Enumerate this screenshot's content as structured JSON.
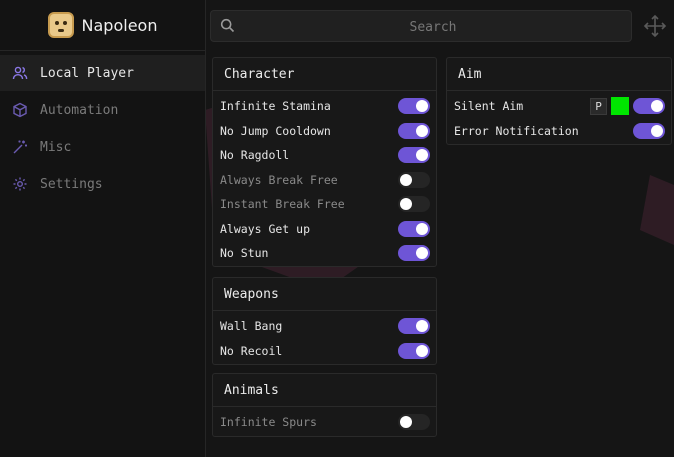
{
  "app": {
    "title": "Napoleon"
  },
  "sidebar": {
    "items": [
      {
        "label": "Local Player",
        "icon": "users-icon",
        "active": true
      },
      {
        "label": "Automation",
        "icon": "cube-icon",
        "active": false
      },
      {
        "label": "Misc",
        "icon": "wand-icon",
        "active": false
      },
      {
        "label": "Settings",
        "icon": "gear-icon",
        "active": false
      }
    ]
  },
  "search": {
    "placeholder": "Search",
    "value": ""
  },
  "accent_color": "#6e55d6",
  "panels": {
    "character": {
      "title": "Character",
      "rows": [
        {
          "label": "Infinite Stamina",
          "on": true,
          "enabled": true
        },
        {
          "label": "No Jump Cooldown",
          "on": true,
          "enabled": true
        },
        {
          "label": "No Ragdoll",
          "on": true,
          "enabled": true
        },
        {
          "label": "Always Break Free",
          "on": false,
          "enabled": false
        },
        {
          "label": "Instant Break Free",
          "on": false,
          "enabled": false
        },
        {
          "label": "Always Get up",
          "on": true,
          "enabled": true
        },
        {
          "label": "No Stun",
          "on": true,
          "enabled": true
        }
      ]
    },
    "weapons": {
      "title": "Weapons",
      "rows": [
        {
          "label": "Wall Bang",
          "on": true,
          "enabled": true
        },
        {
          "label": "No Recoil",
          "on": true,
          "enabled": true
        }
      ]
    },
    "animals": {
      "title": "Animals",
      "rows": [
        {
          "label": "Infinite Spurs",
          "on": false,
          "enabled": false
        }
      ]
    },
    "aim": {
      "title": "Aim",
      "rows": [
        {
          "label": "Silent Aim",
          "on": true,
          "enabled": true,
          "keybind": "P",
          "color": "#00e600"
        },
        {
          "label": "Error Notification",
          "on": true,
          "enabled": true
        }
      ]
    }
  }
}
